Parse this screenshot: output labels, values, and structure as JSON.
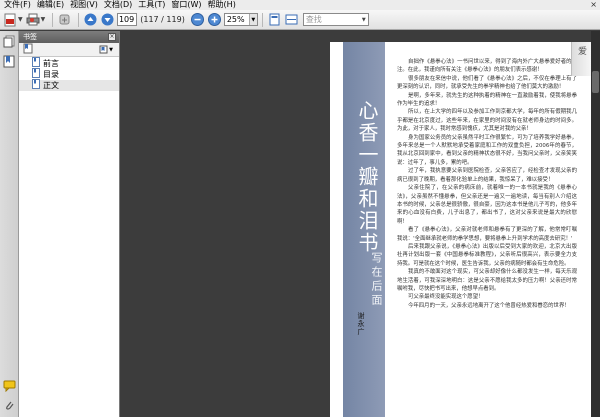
{
  "menu": {
    "items": [
      "文件(F)",
      "编辑(E)",
      "视图(V)",
      "文档(D)",
      "工具(T)",
      "窗口(W)",
      "帮助(H)"
    ],
    "close": "×"
  },
  "toolbar": {
    "current_page": "109",
    "page_count": "(117 / 119)",
    "zoom": "25%",
    "search_placeholder": "查找"
  },
  "bookmarks": {
    "title": "书签",
    "close": "×",
    "items": [
      {
        "label": "前言",
        "selected": false
      },
      {
        "label": "目录",
        "selected": false
      },
      {
        "label": "正文",
        "selected": true
      }
    ]
  },
  "document": {
    "title": "心香一瓣和泪书",
    "subtitle": "写在后面",
    "author": "谢永广",
    "fold_glyph": "爱",
    "paragraphs": [
      "自拙作《悬拳心法》一书问世以来，得到了海内外广大悬拳爱好者的关注。在此，我谨向所有关注《悬拳心法》的朋友们表示感谢！",
      "很多朋友在来信中说，他们看了《悬拳心法》之后，不仅在拳理上有了更深刻的认识，同时，就承受先生的拳学精神也给了他们莫大的激励！",
      "是啊，多年来，就先生的这种执着的精神在一直激励着我，使我将悬拳作为毕生的追求！",
      "所以，在上大学的四年以及参加工作到京都大学，每年的所有假期我几乎都是在北京度过，这些年来，在家里的时间没有在就老师身边的时间多。为此，对于家人，我时常感到愧疚，尤其是对我的父亲！",
      "身为国家公务员的父亲虽然平时工作很繁忙，可为了培养我学好悬拳，多年来总是一个人默默地承受着家庭和工作的双重负担，2006年的春节，我从北京回到家中，看到父亲的精神状态很不好，当我问父亲时，父亲笑笑说：过年了，事儿多，累的吧。",
      "过了年，我执意要父亲到医院检查，父亲答应了，经检查才发现父亲的病已很到了晚期，看着那化验单上的结果，我惊呆了，难以接受！",
      "父亲住院了，在父亲的病床前，就着唯一的一本书就是我的《悬拳心法》，父亲虽然不懂悬拳，但父亲还是一遍又一遍地读，每当有别人介绍这本书的时候，父亲总是很骄傲，很自豪，因为这本书是他儿子写的，他多年来的心血没有白费，儿子出息了，都出书了，这对父亲来说是最大的欣慰啊！",
      "看了《悬拳心法》，父亲对就老师和悬拳有了更深的了解，他常常叮嘱我说：'全面继承就老师的拳学思想，要将悬拳上升到学术的高度去研究！'",
      "后来我跟父亲说，《悬拳心法》出版以后受到大家的欢迎，北京大出版社再计划出版一套《中国悬拳标准教程》，父亲听后很高兴，表示要全力支持我。可是就在这个时候，医生告诉我，父亲的病随时都会有生命危险。",
      "我真的不敢面对这个现实，可父亲却好像什么都没发生一样，每天乐观地生活着，可我深深地明白：这是父亲不愿给我太多的压力啊！父亲还时常嘱咐我，尽快把书写出来，他想早点看到。",
      "可父亲最终没能实现这个愿望！",
      "今年四月的一天，父亲永远地离开了这个他曾经热爱和眷恋的世界！"
    ]
  },
  "colors": {
    "band": "#7e8eae",
    "app_bg": "#3c3c3c",
    "panel_head": "#6e6e6e"
  },
  "icons": [
    "pdf-save-icon",
    "print-icon",
    "hand-tool-icon",
    "prev-page-icon",
    "next-page-icon",
    "zoom-out-icon",
    "zoom-in-icon",
    "fit-page-icon",
    "fit-width-icon",
    "pages-icon",
    "bookmarks-icon",
    "comments-icon",
    "attachment-icon"
  ]
}
